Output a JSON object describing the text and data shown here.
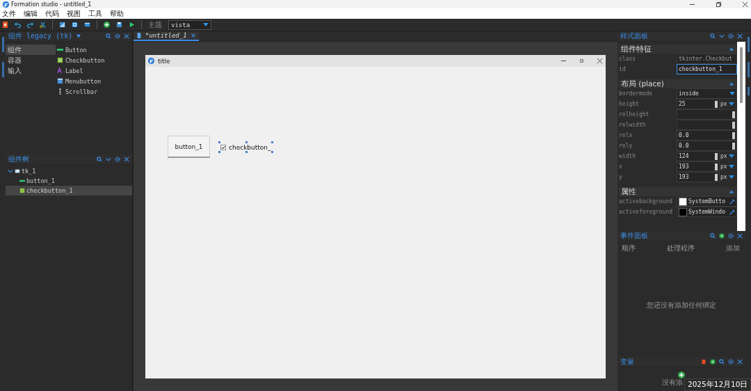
{
  "window": {
    "title": "Formation studio - untitled_1"
  },
  "menu": [
    "文件",
    "编辑",
    "代码",
    "视图",
    "工具",
    "帮助"
  ],
  "toolbar": {
    "theme_label": "主题",
    "theme_value": "vista"
  },
  "components_panel": {
    "title": "组件 legacy (tk)",
    "categories": [
      {
        "label": "组件",
        "selected": true
      },
      {
        "label": "容器",
        "selected": false
      },
      {
        "label": "输入",
        "selected": false
      }
    ],
    "widgets": [
      {
        "label": "Button",
        "kind": "button"
      },
      {
        "label": "Checkbutton",
        "kind": "checkbutton"
      },
      {
        "label": "Label",
        "kind": "label"
      },
      {
        "label": "Menubutton",
        "kind": "menubutton"
      },
      {
        "label": "Scrollbar",
        "kind": "scrollbar"
      }
    ]
  },
  "tree_panel": {
    "title": "组件树",
    "children": [
      {
        "label": "tk_1",
        "kind": "root",
        "expanded": true,
        "selected": false,
        "children": [
          {
            "label": "button_1",
            "kind": "button",
            "selected": false
          },
          {
            "label": "checkbutton_1",
            "kind": "checkbutton",
            "selected": true
          }
        ]
      }
    ]
  },
  "editor": {
    "tab": "*untitled_1",
    "preview": {
      "title": "title",
      "button": "button_1",
      "checkbutton": {
        "label": "checkbutton_",
        "checked": true
      }
    }
  },
  "style_panel": {
    "title": "样式面板",
    "sections": [
      {
        "title": "组件特征",
        "expanded": true,
        "rows": [
          {
            "name": "class",
            "kind": "readonly",
            "value": "tkinter.Checkbut"
          },
          {
            "name": "id",
            "kind": "text",
            "value": "checkbutton_1"
          }
        ]
      },
      {
        "title": "布局 (place)",
        "expanded": true,
        "rows": [
          {
            "name": "bordermode",
            "kind": "select",
            "value": "inside"
          },
          {
            "name": "height",
            "kind": "unit",
            "value": "25",
            "unit": "px"
          },
          {
            "name": "relheight",
            "kind": "spin"
          },
          {
            "name": "relwidth",
            "kind": "spin"
          },
          {
            "name": "relx",
            "kind": "spin",
            "value": "0.0"
          },
          {
            "name": "rely",
            "kind": "spin",
            "value": "0.0"
          },
          {
            "name": "width",
            "kind": "unit",
            "value": "124",
            "unit": "px"
          },
          {
            "name": "x",
            "kind": "unit",
            "value": "193",
            "unit": "px"
          },
          {
            "name": "y",
            "kind": "unit",
            "value": "193",
            "unit": "px"
          }
        ]
      },
      {
        "title": "属性",
        "expanded": true,
        "rows": [
          {
            "name": "activebackground",
            "kind": "color",
            "color": "#ffffff",
            "value": "SystemButto"
          },
          {
            "name": "activeforeground",
            "kind": "color",
            "color": "#000000",
            "value": "SystemWindo"
          }
        ]
      }
    ]
  },
  "event_panel": {
    "title": "事件面板",
    "columns": [
      "顺序",
      "处理程序",
      "添加"
    ],
    "empty": "您还没有添加任何绑定"
  },
  "variable_panel": {
    "title": "变量",
    "empty": "没有添"
  },
  "tooltip": "2025年12月10日"
}
